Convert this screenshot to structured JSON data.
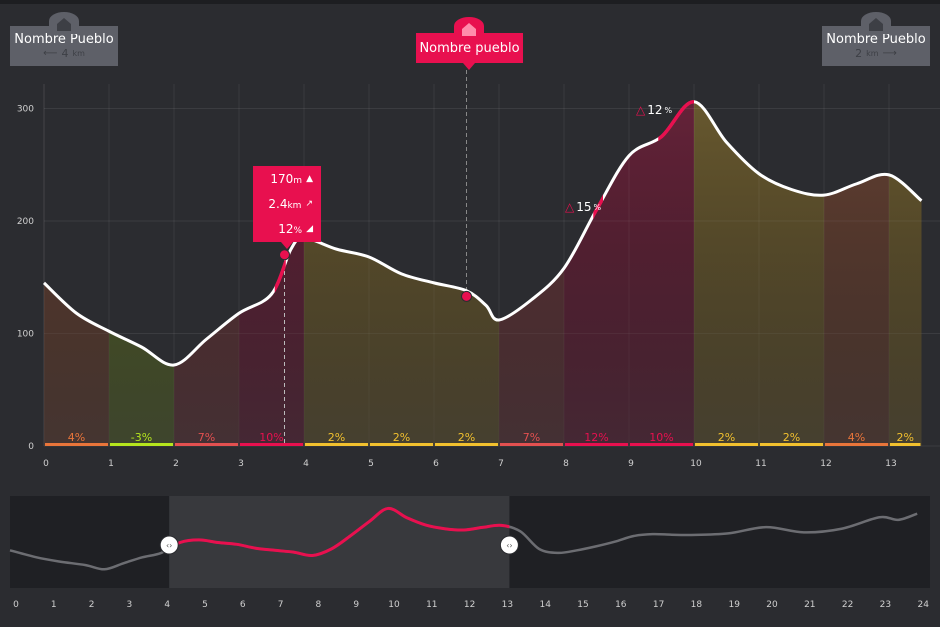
{
  "markers": {
    "left": {
      "name": "Nombre Pueblo",
      "distance": "4",
      "unit": "km"
    },
    "center": {
      "name": "Nombre pueblo"
    },
    "right": {
      "name": "Nombre Pueblo",
      "distance": "2",
      "unit": "km"
    }
  },
  "tooltip": {
    "altitude": "170",
    "altitude_unit": "m",
    "distance": "2.4",
    "distance_unit": "km",
    "slope": "12",
    "slope_unit": "%"
  },
  "slope_callouts": [
    {
      "value": "15",
      "unit": "%"
    },
    {
      "value": "12",
      "unit": "%"
    }
  ],
  "colors": {
    "accent": "#e8104f",
    "line": "#ffffff",
    "orange": "#e9753a",
    "green": "#b5e61d",
    "red": "#e35050",
    "yellow": "#f2c12e",
    "background": "#2b2c30",
    "overview_background": "#1f2024"
  },
  "chart_data": [
    {
      "type": "area",
      "title": "",
      "xlabel": "",
      "ylabel": "",
      "xlim": [
        0,
        13.5
      ],
      "ylim": [
        0,
        320
      ],
      "x_ticks": [
        "0",
        "1",
        "2",
        "3",
        "4",
        "5",
        "6",
        "7",
        "8",
        "9",
        "10",
        "11",
        "12",
        "13"
      ],
      "y_ticks": [
        "0",
        "100",
        "200",
        "300"
      ],
      "grid": true,
      "x": [
        0,
        0.5,
        1,
        1.5,
        2,
        2.5,
        3,
        3.5,
        3.8,
        4,
        4.5,
        5,
        5.5,
        6,
        6.5,
        6.8,
        7,
        7.5,
        8,
        8.5,
        9,
        9.5,
        10,
        10.5,
        11,
        11.5,
        12,
        12.5,
        13,
        13.5
      ],
      "y": [
        145,
        118,
        102,
        88,
        72,
        95,
        118,
        135,
        175,
        185,
        175,
        168,
        153,
        145,
        138,
        125,
        112,
        130,
        158,
        210,
        258,
        275,
        306,
        270,
        242,
        228,
        223,
        233,
        241,
        218
      ],
      "series": [
        {
          "name": "",
          "values": [
            145,
            118,
            102,
            88,
            72,
            95,
            118,
            135,
            175,
            185,
            175,
            168,
            153,
            145,
            138,
            125,
            112,
            130,
            158,
            210,
            258,
            275,
            306,
            270,
            242,
            228,
            223,
            233,
            241,
            218
          ]
        }
      ],
      "segments": [
        {
          "from": 0,
          "to": 1,
          "slope": "4%",
          "color": "orange"
        },
        {
          "from": 1,
          "to": 2,
          "slope": "-3%",
          "color": "green"
        },
        {
          "from": 2,
          "to": 3,
          "slope": "7%",
          "color": "red"
        },
        {
          "from": 3,
          "to": 4,
          "slope": "10%",
          "color": "accent"
        },
        {
          "from": 4,
          "to": 5,
          "slope": "2%",
          "color": "yellow"
        },
        {
          "from": 5,
          "to": 6,
          "slope": "2%",
          "color": "yellow"
        },
        {
          "from": 6,
          "to": 7,
          "slope": "2%",
          "color": "yellow"
        },
        {
          "from": 7,
          "to": 8,
          "slope": "7%",
          "color": "red"
        },
        {
          "from": 8,
          "to": 9,
          "slope": "12%",
          "color": "accent"
        },
        {
          "from": 9,
          "to": 10,
          "slope": "10%",
          "color": "accent"
        },
        {
          "from": 10,
          "to": 11,
          "slope": "2%",
          "color": "yellow"
        },
        {
          "from": 11,
          "to": 12,
          "slope": "2%",
          "color": "yellow"
        },
        {
          "from": 12,
          "to": 13,
          "slope": "4%",
          "color": "orange"
        },
        {
          "from": 13,
          "to": 13.5,
          "slope": "2%",
          "color": "yellow"
        }
      ],
      "points_of_interest": [
        {
          "x": 3.7,
          "y": 170,
          "label": "tooltip"
        },
        {
          "x": 6.5,
          "y": 133,
          "label": "center-marker"
        }
      ]
    },
    {
      "type": "line",
      "title": "",
      "xlim": [
        0,
        24
      ],
      "ylim": [
        0,
        320
      ],
      "x_ticks": [
        "0",
        "1",
        "2",
        "3",
        "4",
        "5",
        "6",
        "7",
        "8",
        "9",
        "10",
        "11",
        "12",
        "13",
        "14",
        "15",
        "16",
        "17",
        "18",
        "19",
        "20",
        "21",
        "22",
        "23",
        "24"
      ],
      "x": [
        0,
        0.7,
        1.3,
        2,
        2.5,
        3,
        3.5,
        4,
        4.5,
        5,
        5.5,
        6,
        6.5,
        7,
        7.5,
        8,
        8.5,
        9,
        9.5,
        10,
        10.5,
        11,
        11.5,
        12,
        12.5,
        13,
        13.5,
        14,
        14.5,
        15,
        15.5,
        16,
        16.5,
        17,
        17.5,
        18,
        19,
        20,
        21,
        22,
        23,
        23.5,
        24
      ],
      "y": [
        145,
        118,
        102,
        88,
        72,
        95,
        118,
        135,
        175,
        185,
        175,
        168,
        153,
        145,
        138,
        125,
        150,
        200,
        255,
        306,
        270,
        242,
        228,
        223,
        233,
        241,
        218,
        150,
        135,
        145,
        160,
        178,
        200,
        207,
        205,
        204,
        210,
        234,
        214,
        228,
        272,
        262,
        286
      ],
      "series": [
        {
          "name": "",
          "values": [
            145,
            118,
            102,
            88,
            72,
            95,
            118,
            135,
            175,
            185,
            175,
            168,
            153,
            145,
            138,
            125,
            150,
            200,
            255,
            306,
            270,
            242,
            228,
            223,
            233,
            241,
            218,
            150,
            135,
            145,
            160,
            178,
            200,
            207,
            205,
            204,
            210,
            234,
            214,
            228,
            272,
            262,
            286
          ]
        }
      ],
      "selection": {
        "from": 4,
        "to": 13
      }
    }
  ]
}
